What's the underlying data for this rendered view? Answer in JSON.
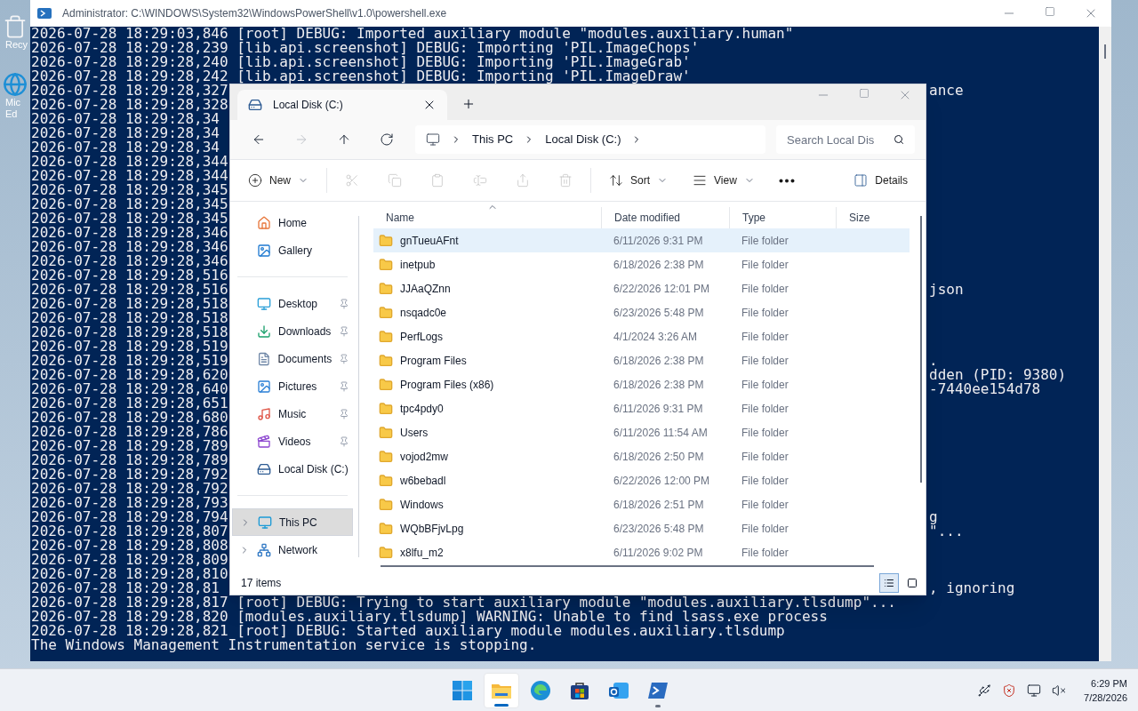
{
  "desktop": {
    "icons": [
      {
        "kind": "recycle-bin",
        "lines": [
          "Recy"
        ]
      },
      {
        "kind": "edge-shortcut",
        "lines": [
          "Mic",
          "Ed"
        ]
      }
    ]
  },
  "console": {
    "title": "Administrator: C:\\WINDOWS\\System32\\WindowsPowerShell\\v1.0\\powershell.exe",
    "lines": [
      {
        "kind": "full",
        "text": "2026-07-28 18:29:03,846 [root] DEBUG: Imported auxiliary module \"modules.auxiliary.human\""
      },
      {
        "kind": "full",
        "text": "2026-07-28 18:29:28,239 [lib.api.screenshot] DEBUG: Importing 'PIL.ImageChops'"
      },
      {
        "kind": "full",
        "text": "2026-07-28 18:29:28,240 [lib.api.screenshot] DEBUG: Importing 'PIL.ImageGrab'"
      },
      {
        "kind": "full",
        "text": "2026-07-28 18:29:28,242 [lib.api.screenshot] DEBUG: Importing 'PIL.ImageDraw'"
      },
      {
        "kind": "split",
        "left": "2026-07-28 18:29:28,327",
        "right": "ance"
      },
      {
        "kind": "split",
        "left": "2026-07-28 18:29:28,328"
      },
      {
        "kind": "split",
        "left": "2026-07-28 18:29:28,34"
      },
      {
        "kind": "split",
        "left": "2026-07-28 18:29:28,34"
      },
      {
        "kind": "split",
        "left": "2026-07-28 18:29:28,34"
      },
      {
        "kind": "split",
        "left": "2026-07-28 18:29:28,344"
      },
      {
        "kind": "split",
        "left": "2026-07-28 18:29:28,344"
      },
      {
        "kind": "split",
        "left": "2026-07-28 18:29:28,345"
      },
      {
        "kind": "split",
        "left": "2026-07-28 18:29:28,345"
      },
      {
        "kind": "split",
        "left": "2026-07-28 18:29:28,345"
      },
      {
        "kind": "split",
        "left": "2026-07-28 18:29:28,346"
      },
      {
        "kind": "split",
        "left": "2026-07-28 18:29:28,346"
      },
      {
        "kind": "split",
        "left": "2026-07-28 18:29:28,346"
      },
      {
        "kind": "split",
        "left": "2026-07-28 18:29:28,516"
      },
      {
        "kind": "split",
        "left": "2026-07-28 18:29:28,516",
        "right": "json"
      },
      {
        "kind": "split",
        "left": "2026-07-28 18:29:28,518"
      },
      {
        "kind": "split",
        "left": "2026-07-28 18:29:28,518"
      },
      {
        "kind": "split",
        "left": "2026-07-28 18:29:28,518"
      },
      {
        "kind": "split",
        "left": "2026-07-28 18:29:28,519"
      },
      {
        "kind": "split",
        "left": "2026-07-28 18:29:28,519",
        "right": "."
      },
      {
        "kind": "split",
        "left": "2026-07-28 18:29:28,620",
        "right": "dden (PID: 9380)"
      },
      {
        "kind": "split",
        "left": "2026-07-28 18:29:28,640",
        "right": "-7440ee154d78"
      },
      {
        "kind": "split",
        "left": "2026-07-28 18:29:28,651"
      },
      {
        "kind": "split",
        "left": "2026-07-28 18:29:28,680"
      },
      {
        "kind": "split",
        "left": "2026-07-28 18:29:28,786"
      },
      {
        "kind": "split",
        "left": "2026-07-28 18:29:28,789"
      },
      {
        "kind": "split",
        "left": "2026-07-28 18:29:28,789"
      },
      {
        "kind": "split",
        "left": "2026-07-28 18:29:28,792"
      },
      {
        "kind": "split",
        "left": "2026-07-28 18:29:28,792"
      },
      {
        "kind": "split",
        "left": "2026-07-28 18:29:28,793"
      },
      {
        "kind": "split",
        "left": "2026-07-28 18:29:28,794",
        "right": "g"
      },
      {
        "kind": "split",
        "left": "2026-07-28 18:29:28,807",
        "right": "\"..."
      },
      {
        "kind": "split",
        "left": "2026-07-28 18:29:28,808"
      },
      {
        "kind": "split",
        "left": "2026-07-28 18:29:28,809"
      },
      {
        "kind": "split",
        "left": "2026-07-28 18:29:28,810"
      },
      {
        "kind": "split",
        "left": "2026-07-28 18:29:28,81",
        "right": ", ignoring"
      },
      {
        "kind": "full",
        "text": "2026-07-28 18:29:28,817 [root] DEBUG: Trying to start auxiliary module \"modules.auxiliary.tlsdump\"..."
      },
      {
        "kind": "full",
        "text": "2026-07-28 18:29:28,820 [modules.auxiliary.tlsdump] WARNING: Unable to find lsass.exe process"
      },
      {
        "kind": "full",
        "text": "2026-07-28 18:29:28,821 [root] DEBUG: Started auxiliary module modules.auxiliary.tlsdump"
      },
      {
        "kind": "full",
        "text": "The Windows Management Instrumentation service is stopping."
      }
    ]
  },
  "explorer": {
    "tab": {
      "label": "Local Disk (C:)"
    },
    "nav_buttons": [
      {
        "kind": "back",
        "disabled": false
      },
      {
        "kind": "forward",
        "disabled": true
      },
      {
        "kind": "up",
        "disabled": false
      },
      {
        "kind": "refresh",
        "disabled": false
      }
    ],
    "breadcrumb": [
      "This PC",
      "Local Disk (C:)"
    ],
    "search": {
      "placeholder": "Search Local Dis"
    },
    "commands": [
      {
        "kind": "new",
        "label": "New",
        "disabled": false
      },
      {
        "kind": "cut",
        "disabled": true
      },
      {
        "kind": "copy",
        "disabled": true
      },
      {
        "kind": "paste",
        "disabled": true
      },
      {
        "kind": "rename",
        "disabled": true
      },
      {
        "kind": "share",
        "disabled": true
      },
      {
        "kind": "delete",
        "disabled": true
      },
      {
        "kind": "sort",
        "label": "Sort",
        "disabled": false
      },
      {
        "kind": "view",
        "label": "View",
        "disabled": false
      },
      {
        "kind": "more",
        "disabled": false
      },
      {
        "kind": "details",
        "label": "Details",
        "disabled": false
      }
    ],
    "sidebar": [
      {
        "kind": "home",
        "label": "Home",
        "pinned": false,
        "selected": false
      },
      {
        "kind": "gallery",
        "label": "Gallery",
        "pinned": false,
        "selected": false
      },
      {
        "kind": "divider"
      },
      {
        "kind": "desktop",
        "label": "Desktop",
        "pinned": true,
        "selected": false
      },
      {
        "kind": "downloads",
        "label": "Downloads",
        "pinned": true,
        "selected": false
      },
      {
        "kind": "documents",
        "label": "Documents",
        "pinned": true,
        "selected": false
      },
      {
        "kind": "pictures",
        "label": "Pictures",
        "pinned": true,
        "selected": false
      },
      {
        "kind": "music",
        "label": "Music",
        "pinned": true,
        "selected": false
      },
      {
        "kind": "videos",
        "label": "Videos",
        "pinned": true,
        "selected": false
      },
      {
        "kind": "drive",
        "label": "Local Disk (C:)",
        "pinned": false,
        "selected": false
      },
      {
        "kind": "divider"
      },
      {
        "kind": "pc",
        "label": "This PC",
        "pinned": false,
        "selected": true,
        "expandable": true
      },
      {
        "kind": "network",
        "label": "Network",
        "pinned": false,
        "selected": false,
        "expandable": true
      }
    ],
    "columns": [
      "Name",
      "Date modified",
      "Type",
      "Size"
    ],
    "rows": [
      {
        "name": "gnTueuAFnt",
        "date": "6/11/2026 9:31 PM",
        "type": "File folder",
        "selected": true
      },
      {
        "name": "inetpub",
        "date": "6/18/2026 2:38 PM",
        "type": "File folder",
        "selected": false
      },
      {
        "name": "JJAaQZnn",
        "date": "6/22/2026 12:01 PM",
        "type": "File folder",
        "selected": false
      },
      {
        "name": "nsqadc0e",
        "date": "6/23/2026 5:48 PM",
        "type": "File folder",
        "selected": false
      },
      {
        "name": "PerfLogs",
        "date": "4/1/2024 3:26 AM",
        "type": "File folder",
        "selected": false
      },
      {
        "name": "Program Files",
        "date": "6/18/2026 2:38 PM",
        "type": "File folder",
        "selected": false
      },
      {
        "name": "Program Files (x86)",
        "date": "6/18/2026 2:38 PM",
        "type": "File folder",
        "selected": false
      },
      {
        "name": "tpc4pdy0",
        "date": "6/11/2026 9:31 PM",
        "type": "File folder",
        "selected": false
      },
      {
        "name": "Users",
        "date": "6/11/2026 11:54 AM",
        "type": "File folder",
        "selected": false
      },
      {
        "name": "vojod2mw",
        "date": "6/18/2026 2:50 PM",
        "type": "File folder",
        "selected": false
      },
      {
        "name": "w6bebadl",
        "date": "6/22/2026 12:00 PM",
        "type": "File folder",
        "selected": false
      },
      {
        "name": "Windows",
        "date": "6/18/2026 2:51 PM",
        "type": "File folder",
        "selected": false
      },
      {
        "name": "WQbBFjvLpg",
        "date": "6/23/2026 5:48 PM",
        "type": "File folder",
        "selected": false
      },
      {
        "name": "x8lfu_m2",
        "date": "6/11/2026 9:02 PM",
        "type": "File folder",
        "selected": false
      }
    ],
    "status": "17 items",
    "views": [
      {
        "kind": "details",
        "selected": true
      },
      {
        "kind": "tiles",
        "selected": false
      }
    ]
  },
  "taskbar": {
    "apps": [
      {
        "kind": "start",
        "active": false,
        "running": false
      },
      {
        "kind": "explorer",
        "active": true,
        "running": true
      },
      {
        "kind": "edge",
        "active": false,
        "running": false
      },
      {
        "kind": "store",
        "active": false,
        "running": false
      },
      {
        "kind": "outlook",
        "active": false,
        "running": false
      },
      {
        "kind": "powershell",
        "active": false,
        "running": true
      }
    ],
    "tray": [
      {
        "kind": "usb"
      },
      {
        "kind": "defender"
      },
      {
        "kind": "network"
      },
      {
        "kind": "volume"
      }
    ],
    "time": "6:29 PM",
    "date": "7/28/2026"
  }
}
